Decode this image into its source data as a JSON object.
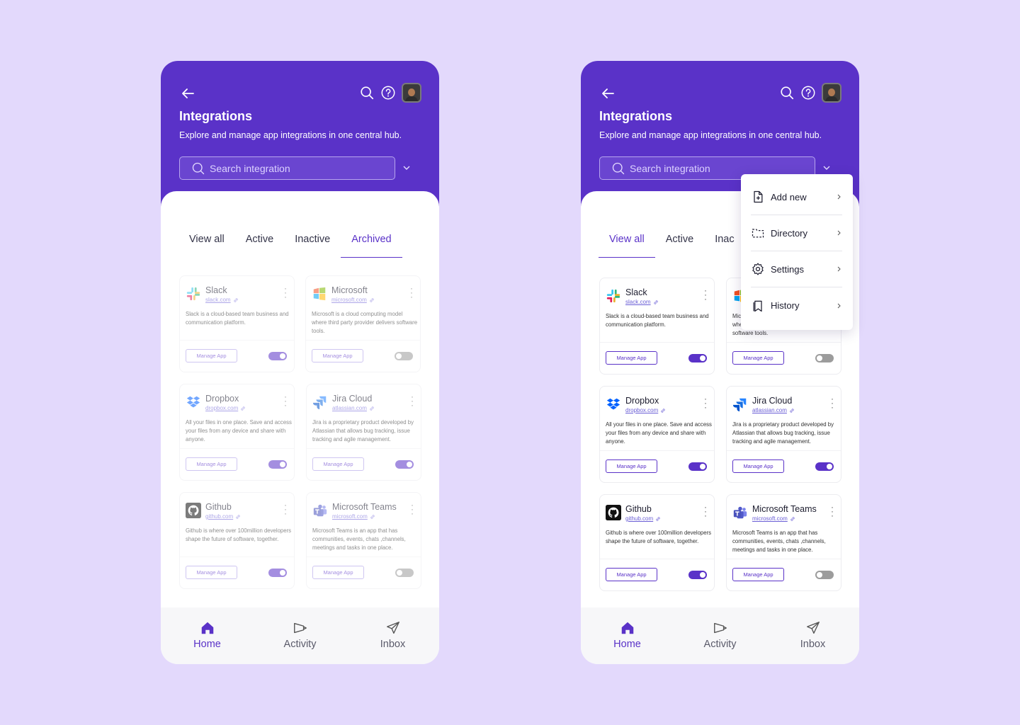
{
  "colors": {
    "brand": "#5a32c8",
    "background": "#e3d9fc",
    "toggle_off": "#9c9c9c"
  },
  "header": {
    "title": "Integrations",
    "subtitle": "Explore and manage app integrations in one central hub.",
    "search_placeholder": "Search integration"
  },
  "icons": {
    "back": "arrow-left-icon",
    "search": "search-icon",
    "help": "help-icon",
    "dropdown": "chevron-down-icon"
  },
  "tabs": [
    "View all",
    "Active",
    "Inactive",
    "Archived"
  ],
  "screen1": {
    "active_tab": "Archived"
  },
  "screen2": {
    "active_tab": "View all",
    "visible_tabs": [
      "View all",
      "Active",
      "Inac"
    ]
  },
  "manage_label": "Manage App",
  "cards": [
    {
      "name": "Slack",
      "url": "slack.com",
      "desc": "Slack is a cloud-based team business and communication platform.",
      "enabled": true
    },
    {
      "name": "Microsoft",
      "url": "microsoft.com",
      "desc": "Microsoft is a cloud computing model where third party provider delivers software tools.",
      "enabled": false
    },
    {
      "name": "Dropbox",
      "url": "dropbox.com",
      "desc": "All your files in one place. Save and access your files from any device and share with anyone.",
      "enabled": true
    },
    {
      "name": "Jira Cloud",
      "url": "atlassian.com",
      "desc": "Jira is a proprietary product developed by Atlassian that allows bug tracking, issue tracking and agile management.",
      "enabled": true
    },
    {
      "name": "Github",
      "url": "github.com",
      "desc": "Github is where over 100million developers shape the future of software, together.",
      "enabled": true
    },
    {
      "name": "Microsoft Teams",
      "url": "microsoft.com",
      "desc": "Microsoft Teams is an app that has communities, events, chats ,channels, meetings and tasks in one place.",
      "enabled": false
    }
  ],
  "microsoft_partial": {
    "desc": [
      "Mic",
      "whe",
      "software tools."
    ]
  },
  "menu": [
    {
      "label": "Add new",
      "icon": "file-plus-icon"
    },
    {
      "label": "Directory",
      "icon": "folder-dashed-icon"
    },
    {
      "label": "Settings",
      "icon": "gear-icon"
    },
    {
      "label": "History",
      "icon": "bookmark-icon"
    }
  ],
  "nav": [
    {
      "label": "Home",
      "icon": "home-icon"
    },
    {
      "label": "Activity",
      "icon": "megaphone-icon"
    },
    {
      "label": "Inbox",
      "icon": "send-icon"
    }
  ]
}
